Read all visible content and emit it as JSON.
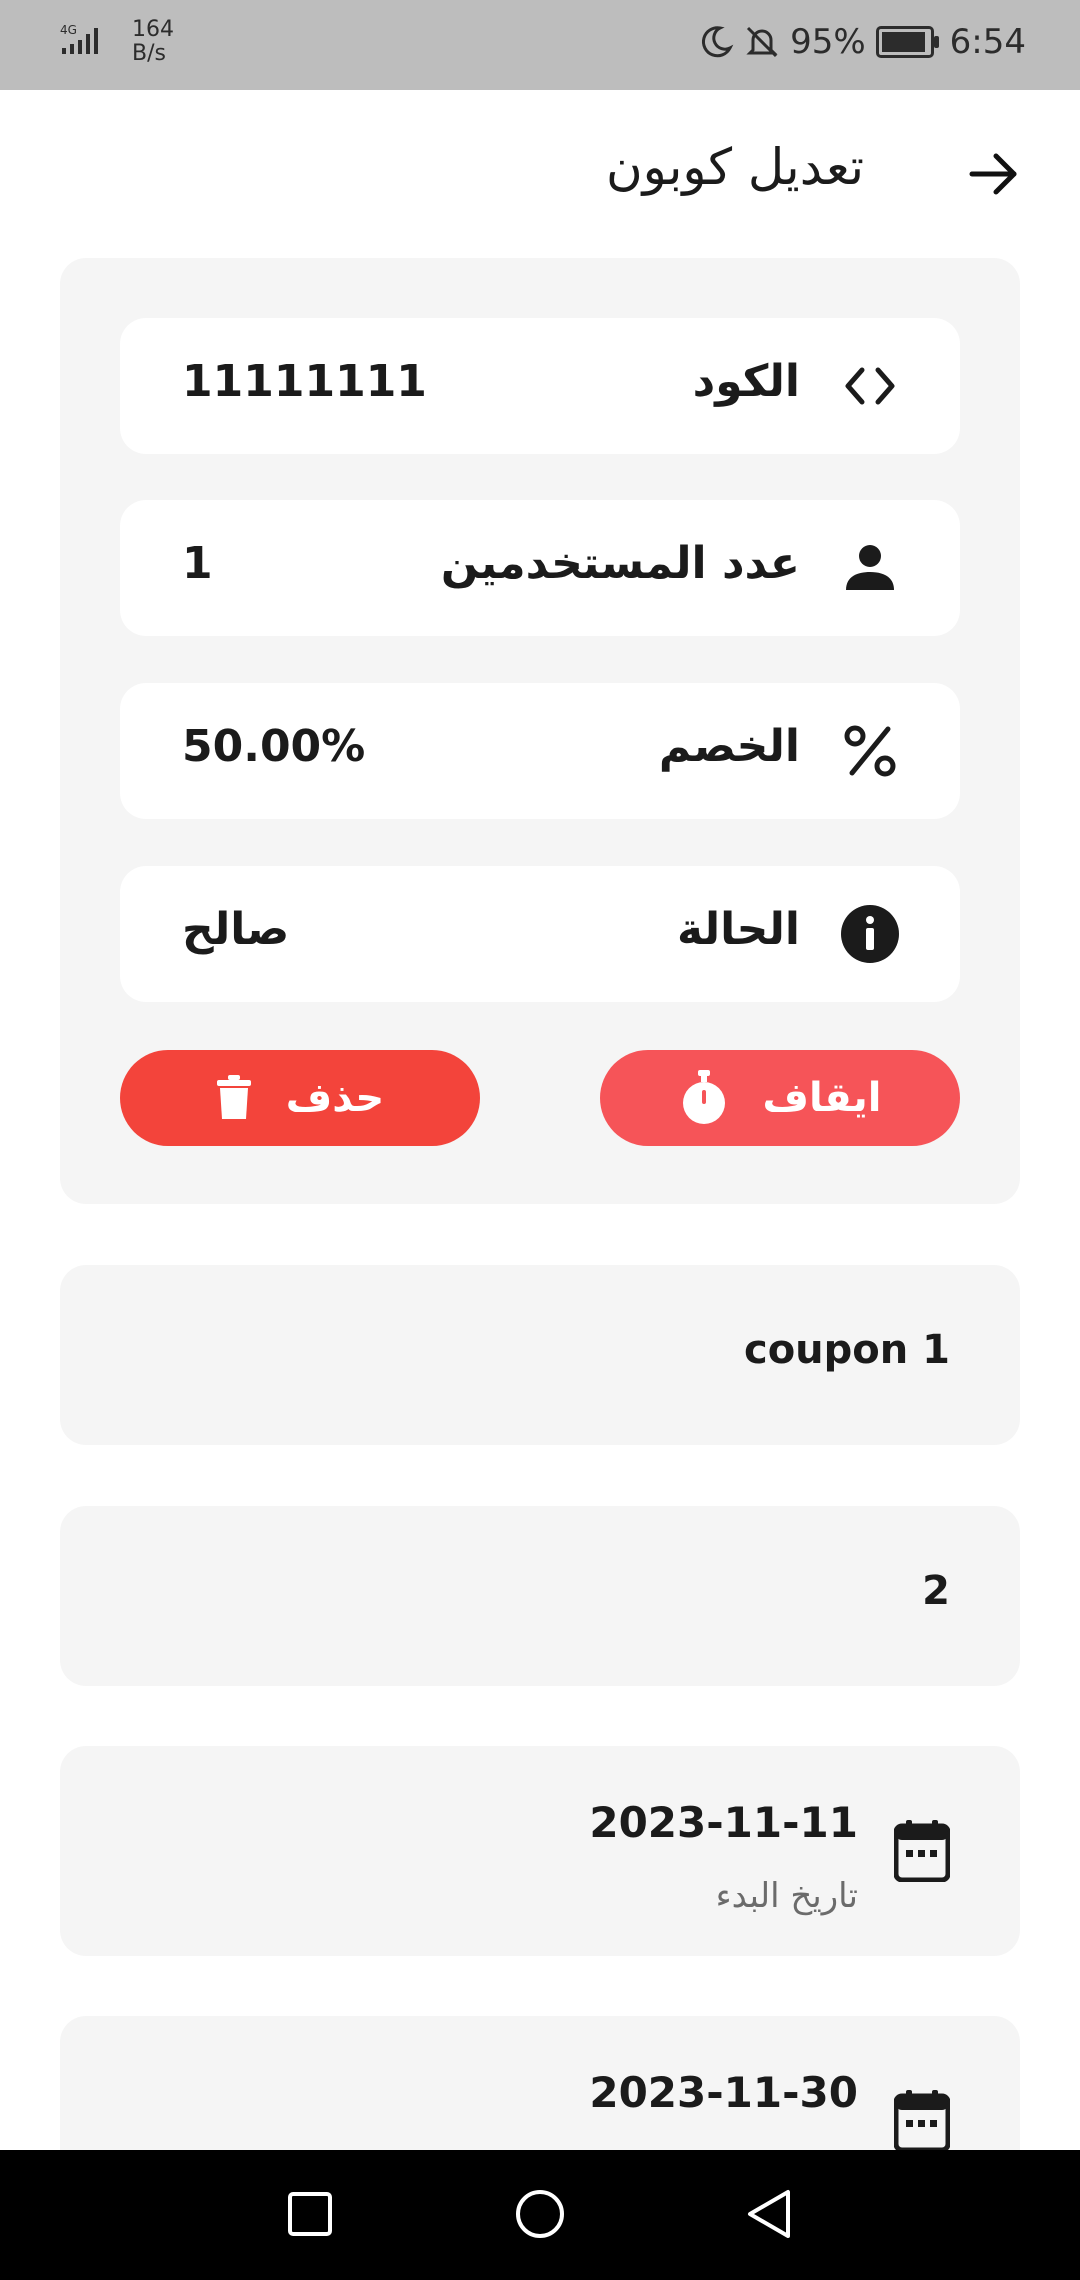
{
  "status_bar": {
    "network": "4G",
    "speed_value": "164",
    "speed_unit": "B/s",
    "battery": "95%",
    "battery_level": 0.95,
    "time": "6:54",
    "icons": [
      "signal-icon",
      "moon-icon",
      "bell-off-icon",
      "battery-icon"
    ]
  },
  "header": {
    "title": "تعديل كوبون",
    "back_icon": "arrow-right-icon"
  },
  "coupon_details": {
    "code": {
      "label": "الكود",
      "value": "11111111",
      "icon": "code-icon"
    },
    "users": {
      "label": "عدد المستخدمين",
      "value": "1",
      "icon": "person-icon"
    },
    "discount": {
      "label": "الخصم",
      "value": "50.00%",
      "icon": "percent-icon"
    },
    "status": {
      "label": "الحالة",
      "value": "صالح",
      "icon": "info-icon"
    }
  },
  "actions": {
    "stop_label": "ايقاف",
    "delete_label": "حذف"
  },
  "coupon_name": "coupon 1",
  "coupon_limit": "2",
  "dates": {
    "start_value": "2023-11-11",
    "start_label": "تاريخ البدء",
    "end_value": "2023-11-30"
  },
  "colors": {
    "stop_button": "#f65458",
    "delete_button": "#f3443b",
    "card_bg": "#f5f5f5"
  }
}
